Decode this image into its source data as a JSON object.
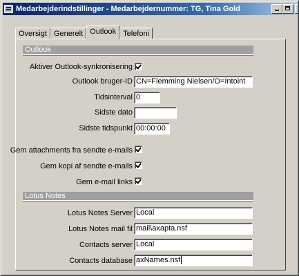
{
  "window": {
    "title": "Medarbejderindstillinger - Medarbejdernummer: TG, Tina Gold"
  },
  "tabs": [
    {
      "label": "Oversigt"
    },
    {
      "label": "Generelt"
    },
    {
      "label": "Outlook",
      "active": true
    },
    {
      "label": "Telefoni"
    }
  ],
  "outlook": {
    "header": "Outlook",
    "sync_label": "Aktiver Outlook-synkronisering",
    "sync_checked": true,
    "user_id_label": "Outlook bruger-ID",
    "user_id_value": "CN=Flemming Nielsen/O=Intoint",
    "interval_label": "Tidsinterval",
    "interval_value": "0",
    "last_date_label": "Sidste dato",
    "last_date_value": "",
    "last_time_label": "Sidste tidspunkt",
    "last_time_value": "00:00:00",
    "save_attachments_label": "Gem attachments fra sendte e-mails",
    "save_copy_label": "Gem kopi af sendte e-mails",
    "save_links_label": "Gem e-mail links"
  },
  "lotus": {
    "header": "Lotus Notes",
    "server_label": "Lotus Notes Server",
    "server_value": "Local",
    "mailfile_label": "Lotus Notes mail fil",
    "mailfile_value": "mail\\axapta.nsf",
    "contacts_server_label": "Contacts server",
    "contacts_server_value": "Local",
    "contacts_db_label": "Contacts database",
    "contacts_db_value": "axNames.nsf"
  },
  "colors": {
    "face": "#d4d0c8",
    "titlebar_start": "#0a246a",
    "titlebar_end": "#a6caf0",
    "group_header": "#a0a0a0"
  }
}
